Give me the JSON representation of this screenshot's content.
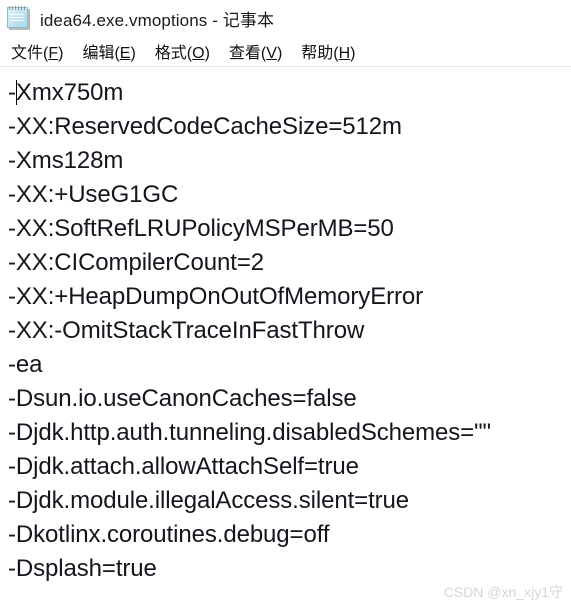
{
  "window": {
    "title": "idea64.exe.vmoptions - 记事本",
    "icon": "notepad-icon"
  },
  "menubar": {
    "items": [
      {
        "label": "文件(F)",
        "head": "文件(",
        "key": "F",
        "tail": ")"
      },
      {
        "label": "编辑(E)",
        "head": "编辑(",
        "key": "E",
        "tail": ")"
      },
      {
        "label": "格式(O)",
        "head": "格式(",
        "key": "O",
        "tail": ")"
      },
      {
        "label": "查看(V)",
        "head": "查看(",
        "key": "V",
        "tail": ")"
      },
      {
        "label": "帮助(H)",
        "head": "帮助(",
        "key": "H",
        "tail": ")"
      }
    ]
  },
  "editor": {
    "caret_line": 0,
    "caret_column": 1,
    "lines": [
      {
        "prefix": "-",
        "rest": "Xmx750m",
        "full": "-Xmx750m"
      },
      {
        "full": "-XX:ReservedCodeCacheSize=512m"
      },
      {
        "full": "-Xms128m"
      },
      {
        "full": "-XX:+UseG1GC"
      },
      {
        "full": "-XX:SoftRefLRUPolicyMSPerMB=50"
      },
      {
        "full": "-XX:CICompilerCount=2"
      },
      {
        "full": "-XX:+HeapDumpOnOutOfMemoryError"
      },
      {
        "full": "-XX:-OmitStackTraceInFastThrow"
      },
      {
        "full": "-ea"
      },
      {
        "full": "-Dsun.io.useCanonCaches=false"
      },
      {
        "full": "-Djdk.http.auth.tunneling.disabledSchemes=\"\""
      },
      {
        "full": "-Djdk.attach.allowAttachSelf=true"
      },
      {
        "full": "-Djdk.module.illegalAccess.silent=true"
      },
      {
        "full": "-Dkotlinx.coroutines.debug=off"
      },
      {
        "full": "-Dsplash=true"
      }
    ]
  },
  "watermark": {
    "text": "CSDN @xn_xjy1守"
  },
  "colors": {
    "text": "#13161c",
    "background": "#ffffff",
    "menu_text": "#111111",
    "watermark": "#cfcfcf"
  }
}
